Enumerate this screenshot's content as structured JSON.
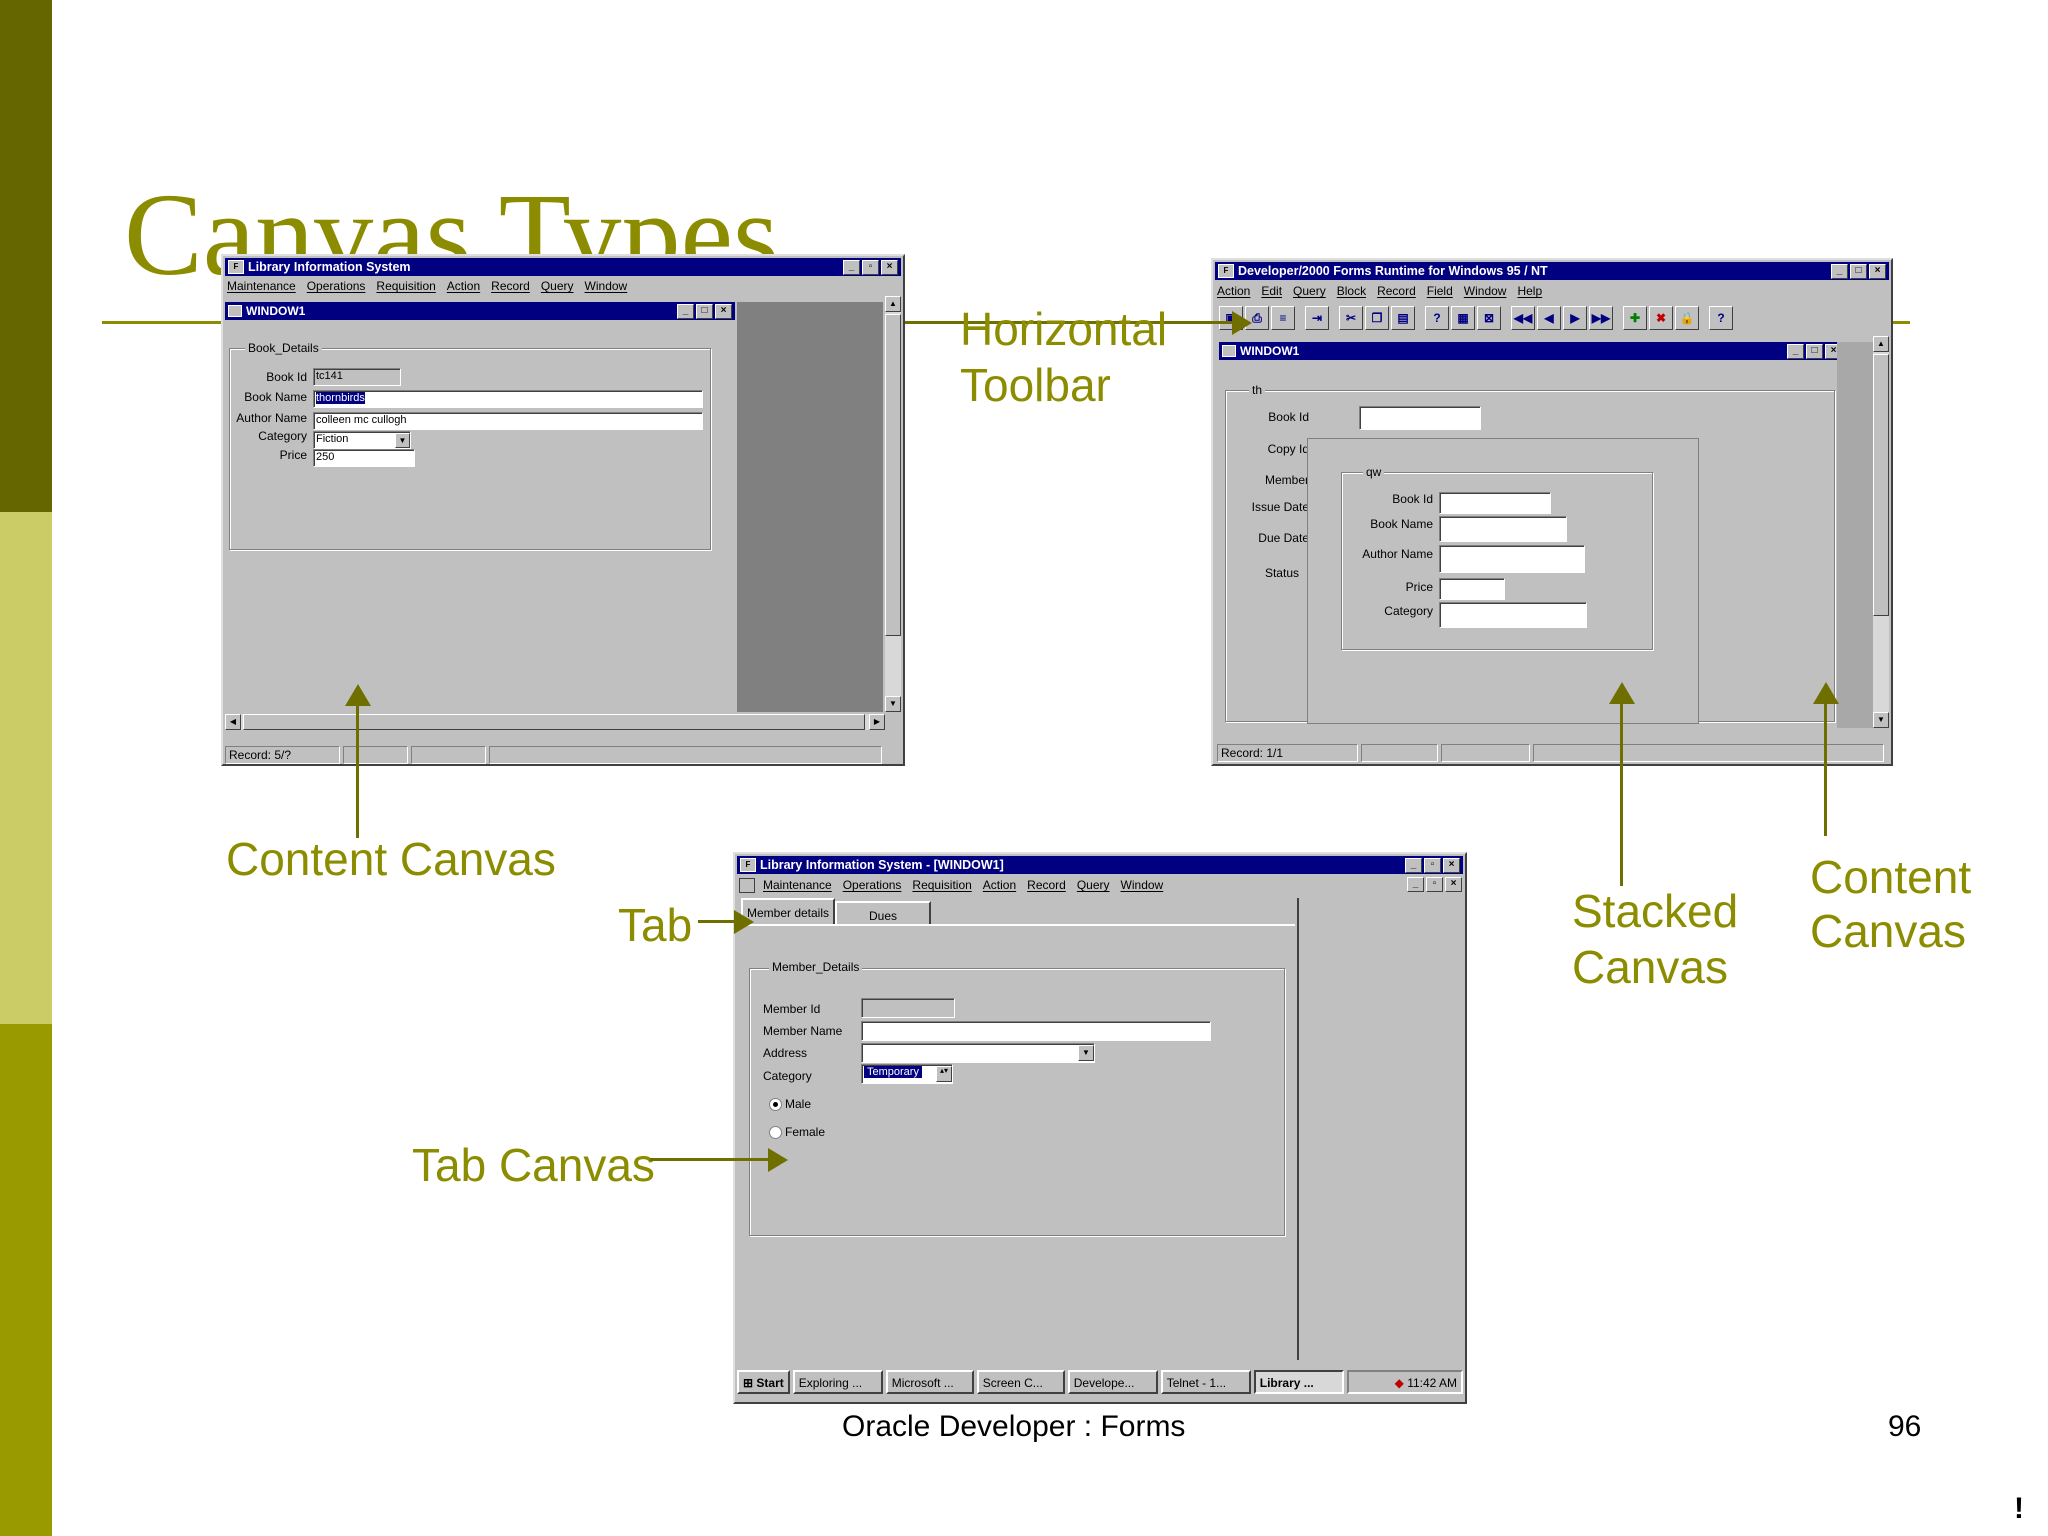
{
  "slide": {
    "title": "Canvas Types",
    "footer": "Oracle Developer : Forms",
    "page_number": "96",
    "corner_mark": "!"
  },
  "callouts": {
    "content_canvas_left": "Content Canvas",
    "horizontal_toolbar": [
      "Horizontal",
      "Toolbar"
    ],
    "tab": "Tab",
    "tab_canvas": "Tab Canvas",
    "stacked_canvas": [
      "Stacked",
      "Canvas"
    ],
    "content_canvas_right": [
      "Content",
      "Canvas"
    ]
  },
  "win1": {
    "title": "Library Information System",
    "menu": [
      "Maintenance",
      "Operations",
      "Requisition",
      "Action",
      "Record",
      "Query",
      "Window"
    ],
    "inner_title": "WINDOW1",
    "group": "Book_Details",
    "labels": [
      "Book Id",
      "Book Name",
      "Author Name",
      "Category",
      "Price"
    ],
    "values": {
      "book_id": "tc141",
      "book_name": "thornbirds",
      "author_name": "colleen mc cullogh",
      "category": "Fiction",
      "price": "250"
    },
    "status": "Record: 5/?"
  },
  "win2": {
    "title": "Developer/2000 Forms Runtime for Windows 95 / NT",
    "menu": [
      "Action",
      "Edit",
      "Query",
      "Block",
      "Record",
      "Field",
      "Window",
      "Help"
    ],
    "inner_title": "WINDOW1",
    "group_outer": "th",
    "labels_outer": [
      "Book Id",
      "Copy Id",
      "Member",
      "Issue Date",
      "Due Date",
      "Status"
    ],
    "group_stacked": "qw",
    "labels_stacked": [
      "Book Id",
      "Book Name",
      "Author Name",
      "Price",
      "Category"
    ],
    "status": "Record: 1/1",
    "toolbar_icons": [
      "save-icon",
      "print-icon",
      "print-setup-icon",
      "exit-icon",
      "cut-icon",
      "copy-icon",
      "paste-icon",
      "enter-query-icon",
      "execute-query-icon",
      "cancel-query-icon",
      "first-record-icon",
      "previous-record-icon",
      "next-record-icon",
      "last-record-icon",
      "insert-record-icon",
      "delete-record-icon",
      "lock-record-icon",
      "help-icon"
    ]
  },
  "win3": {
    "title": "Library Information System - [WINDOW1]",
    "menu": [
      "Maintenance",
      "Operations",
      "Requisition",
      "Action",
      "Record",
      "Query",
      "Window"
    ],
    "tabs": [
      "Member details",
      "Dues"
    ],
    "group": "Member_Details",
    "labels": [
      "Member Id",
      "Member Name",
      "Address",
      "Category"
    ],
    "category_value": "Temporary",
    "radios": [
      "Male",
      "Female"
    ],
    "taskbar": {
      "start": "Start",
      "items": [
        "Exploring ...",
        "Microsoft ...",
        "Screen C...",
        "Develope...",
        "Telnet - 1...",
        "Library ..."
      ],
      "clock": "11:42 AM"
    }
  }
}
